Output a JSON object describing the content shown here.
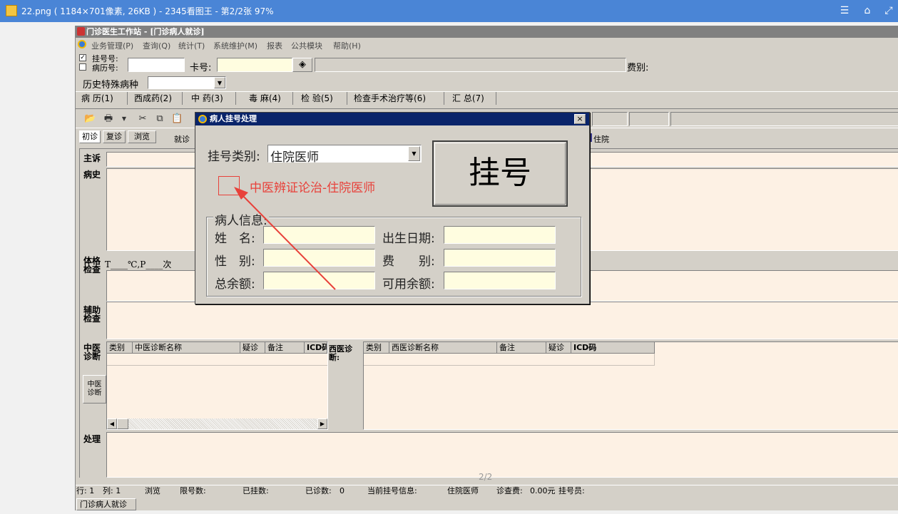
{
  "viewer": {
    "title": "22.png ( 1184×701像素, 26KB ) - 2345看图王 - 第2/2张 97%",
    "page_indicator": "2/2"
  },
  "app": {
    "title": "门诊医生工作站 - [门诊病人就诊]",
    "menu": [
      "业务管理(P)",
      "查询(Q)",
      "统计(T)",
      "系统维护(M)",
      "报表",
      "公共模块",
      "帮助(H)"
    ],
    "reg_no_label": "挂号号:",
    "record_no_label": "病历号:",
    "card_label": "卡号:",
    "fee_type_label": "费别:",
    "history_label": "历史特殊病种",
    "tabs": [
      "病 历(1)",
      "西成药(2)",
      "中 药(3)",
      "毒 麻(4)",
      "检 验(5)",
      "检查手术治疗等(6)",
      "汇 总(7)"
    ],
    "subtabs": [
      "初诊",
      "复诊",
      "浏览",
      "就诊"
    ],
    "inpatient_label": "住院",
    "sections": {
      "complaint": "主诉",
      "history": "病史",
      "exam": "体格检查",
      "exam_vitals": "T____℃,P____次",
      "aux_exam": "辅助检查",
      "tcm_diag": "中医诊断",
      "tcm_button": "中医诊断",
      "western_diag": "西医诊断:",
      "treatment": "处理"
    },
    "tcm_columns": [
      "类别",
      "中医诊断名称",
      "疑诊",
      "备注",
      "ICD码"
    ],
    "western_columns": [
      "类别",
      "西医诊断名称",
      "备注",
      "疑诊",
      "ICD码"
    ],
    "status": {
      "row": "行: 1",
      "col": "列: 1",
      "mode": "浏览",
      "limit_label": "限号数:",
      "registered_label": "已挂数:",
      "seen_label": "已诊数:",
      "seen_value": "0",
      "current_label": "当前挂号信息:",
      "current_value": "住院医师",
      "fee_label": "诊查费:",
      "fee_value": "0.00元",
      "clerk_label": "挂号员:"
    },
    "task_tab": "门诊病人就诊"
  },
  "dialog": {
    "title": "病人挂号处理",
    "close": "×",
    "reg_type_label": "挂号类别:",
    "reg_type_value": "住院医师",
    "checkbox_label": "中医辨证论治-住院医师",
    "register_button": "挂号",
    "group_title": "病人信息:",
    "name_label": "姓　名:",
    "dob_label": "出生日期:",
    "gender_label": "性　别:",
    "fee_label": "费　　别:",
    "balance_label": "总余额:",
    "available_label": "可用余额:"
  },
  "colors": {
    "annotation": "#e8413a",
    "window_bg": "#d4d0c8",
    "titlebar": "#0a246a",
    "field_bg": "#fffde0"
  }
}
